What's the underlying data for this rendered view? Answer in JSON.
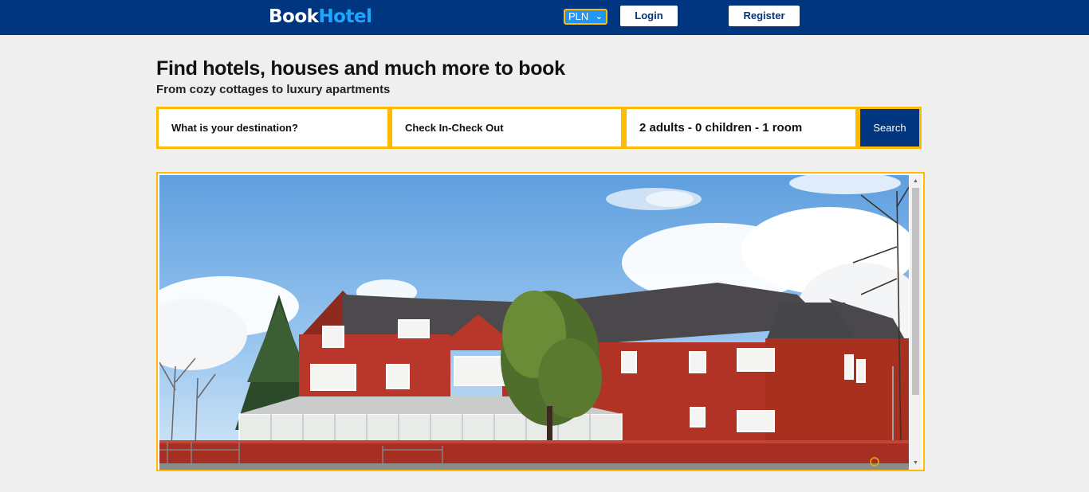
{
  "header": {
    "logo_part1": "Book",
    "logo_part2": "Hotel",
    "currency": "PLN",
    "login_label": "Login",
    "register_label": "Register",
    "brand_color": "#003580",
    "accent_color": "#febb02"
  },
  "hero": {
    "title": "Find hotels, houses and much more to book",
    "subtitle": "From cozy cottages to luxury apartments"
  },
  "search": {
    "destination_placeholder": "What is your destination?",
    "dates_placeholder": "Check In-Check Out",
    "guests_value": "2 adults - 0 children - 1 room",
    "search_label": "Search"
  },
  "gallery": {
    "image": "hotel-building-photo"
  }
}
